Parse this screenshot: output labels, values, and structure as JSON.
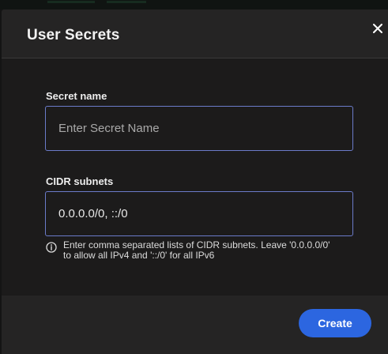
{
  "dialog": {
    "title": "User Secrets",
    "close_icon": "close-icon"
  },
  "form": {
    "secret_name": {
      "label": "Secret name",
      "placeholder": "Enter Secret Name",
      "value": ""
    },
    "cidr_subnets": {
      "label": "CIDR subnets",
      "value": "0.0.0.0/0, ::/0",
      "hint": "Enter comma separated lists of CIDR subnets. Leave '0.0.0.0/0' to allow all IPv4 and '::/0' for all IPv6",
      "hint_icon": "info-icon"
    }
  },
  "footer": {
    "create_label": "Create"
  },
  "colors": {
    "accent": "#2c66e0",
    "input_border": "#6b7bc9",
    "dialog_bg": "#252424",
    "body_bg": "#1c1b1b"
  }
}
